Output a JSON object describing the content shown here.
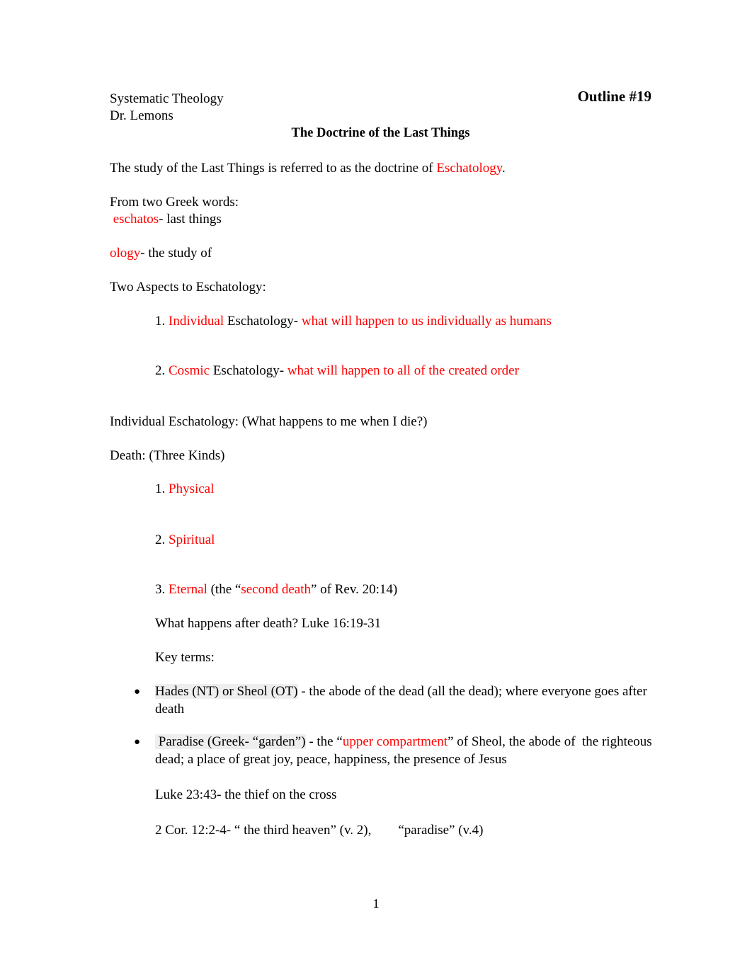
{
  "header": {
    "course": "Systematic Theology",
    "instructor": "Dr. Lemons",
    "outline_number": "Outline #19",
    "title": "The Doctrine of the Last Things"
  },
  "accent_color": "#ff0000",
  "body": {
    "intro_prefix": "The study of the Last Things is referred to as the doctrine of ",
    "intro_term": "Eschatology",
    "intro_suffix": ".",
    "greek_words_heading": "From two Greek words:",
    "eschatos_term": " eschatos",
    "eschatos_def": "- last things",
    "ology_term": "ology",
    "ology_def": "- the study of",
    "two_aspects_heading": "Two Aspects to Eschatology:",
    "aspect_1_number": "1. ",
    "aspect_1_term": "Individual",
    "aspect_1_middle": " Eschatology- ",
    "aspect_1_desc": "what will happen to us individually as humans",
    "aspect_2_number": "2. ",
    "aspect_2_term": "Cosmic",
    "aspect_2_middle": " Eschatology- ",
    "aspect_2_desc": "what will happen to all of the created order",
    "individual_esch_heading": "Individual Eschatology: (What happens to me when I die?)",
    "death_heading": "Death: (Three Kinds)",
    "death_1_number": "1. ",
    "death_1_term": "Physical",
    "death_2_number": "2. ",
    "death_2_term": "Spiritual",
    "death_3_number": "3. ",
    "death_3_term": "Eternal",
    "death_3_mid_a": " (the “",
    "death_3_red": "second death",
    "death_3_mid_b": "” of Rev. 20:14)",
    "after_death_line": "What happens after death? Luke 16:19-31",
    "key_terms_heading": "Key terms:",
    "bullet_1_shaded": "Hades (NT) or Sheol (OT)",
    "bullet_1_rest": " - the abode of the dead (all the dead); where everyone goes after death",
    "bullet_2_shaded": " Paradise (Greek- “garden”)",
    "bullet_2_mid_a": " - the “",
    "bullet_2_red": "upper compartment",
    "bullet_2_mid_b": "” of Sheol, the abode of  the righteous dead; a place of great joy, peace, happiness, the presence of Jesus",
    "luke_line": "Luke 23:43- the thief on the cross",
    "cor_line": "2 Cor. 12:2-4- “ the third heaven” (v. 2),        “paradise” (v.4)"
  },
  "footer": {
    "page_number": "1"
  }
}
